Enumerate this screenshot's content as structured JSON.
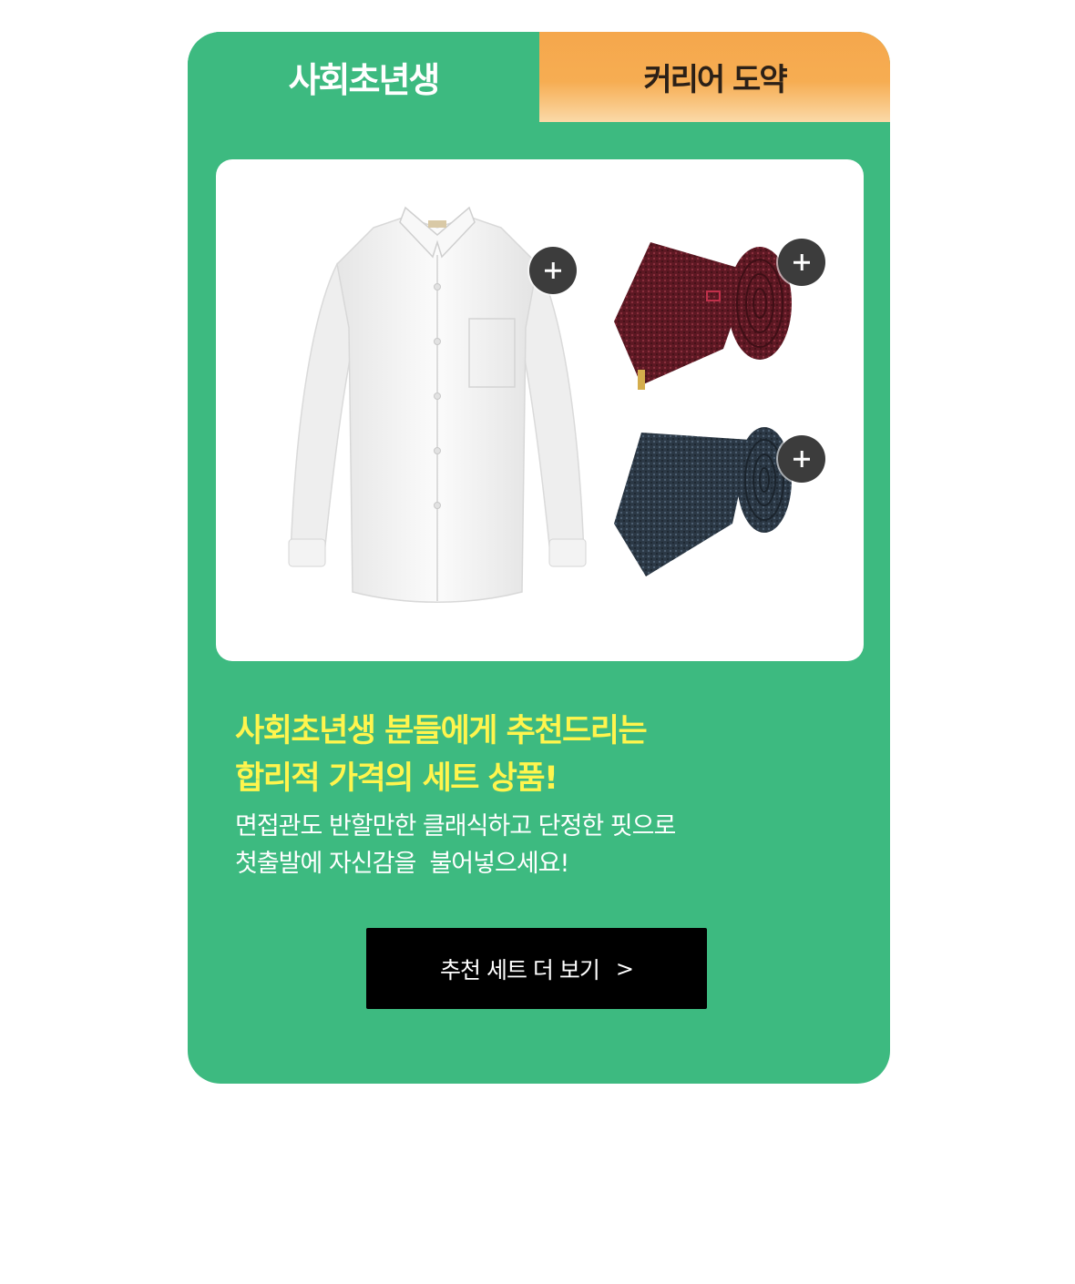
{
  "tabs": [
    {
      "label": "사회초년생",
      "active": true
    },
    {
      "label": "커리어 도약",
      "active": false
    }
  ],
  "products": [
    {
      "name": "white-dress-shirt",
      "color": "#f4f4f4"
    },
    {
      "name": "burgundy-tie",
      "color": "#6e1f2a"
    },
    {
      "name": "navy-tie",
      "color": "#2e3d4c"
    }
  ],
  "headline": {
    "line1": "사회초년생 분들에게 추천드리는",
    "line2": "합리적 가격의 세트 상품!"
  },
  "description": {
    "line1": "면접관도 반할만한 클래식하고 단정한 핏으로",
    "line2": "첫출발에 자신감을  불어넣으세요!"
  },
  "cta": {
    "label": "추천 세트 더 보기",
    "arrow": ">"
  },
  "colors": {
    "card_bg": "#3dba80",
    "tab_inactive": "#f5a74c",
    "headline": "#fff54d",
    "button_bg": "#000000"
  }
}
